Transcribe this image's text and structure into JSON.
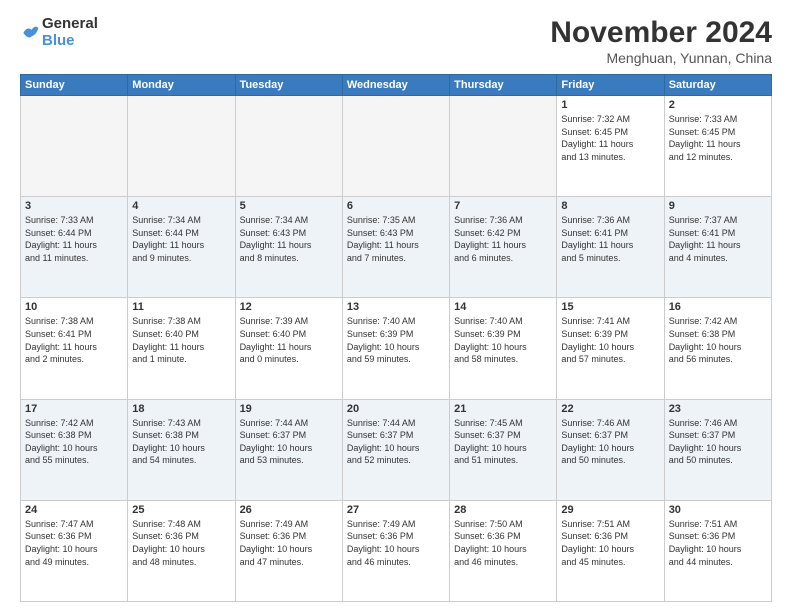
{
  "logo": {
    "line1": "General",
    "line2": "Blue"
  },
  "title": "November 2024",
  "subtitle": "Menghuan, Yunnan, China",
  "days_header": [
    "Sunday",
    "Monday",
    "Tuesday",
    "Wednesday",
    "Thursday",
    "Friday",
    "Saturday"
  ],
  "weeks": [
    [
      {
        "num": "",
        "info": ""
      },
      {
        "num": "",
        "info": ""
      },
      {
        "num": "",
        "info": ""
      },
      {
        "num": "",
        "info": ""
      },
      {
        "num": "",
        "info": ""
      },
      {
        "num": "1",
        "info": "Sunrise: 7:32 AM\nSunset: 6:45 PM\nDaylight: 11 hours\nand 13 minutes."
      },
      {
        "num": "2",
        "info": "Sunrise: 7:33 AM\nSunset: 6:45 PM\nDaylight: 11 hours\nand 12 minutes."
      }
    ],
    [
      {
        "num": "3",
        "info": "Sunrise: 7:33 AM\nSunset: 6:44 PM\nDaylight: 11 hours\nand 11 minutes."
      },
      {
        "num": "4",
        "info": "Sunrise: 7:34 AM\nSunset: 6:44 PM\nDaylight: 11 hours\nand 9 minutes."
      },
      {
        "num": "5",
        "info": "Sunrise: 7:34 AM\nSunset: 6:43 PM\nDaylight: 11 hours\nand 8 minutes."
      },
      {
        "num": "6",
        "info": "Sunrise: 7:35 AM\nSunset: 6:43 PM\nDaylight: 11 hours\nand 7 minutes."
      },
      {
        "num": "7",
        "info": "Sunrise: 7:36 AM\nSunset: 6:42 PM\nDaylight: 11 hours\nand 6 minutes."
      },
      {
        "num": "8",
        "info": "Sunrise: 7:36 AM\nSunset: 6:41 PM\nDaylight: 11 hours\nand 5 minutes."
      },
      {
        "num": "9",
        "info": "Sunrise: 7:37 AM\nSunset: 6:41 PM\nDaylight: 11 hours\nand 4 minutes."
      }
    ],
    [
      {
        "num": "10",
        "info": "Sunrise: 7:38 AM\nSunset: 6:41 PM\nDaylight: 11 hours\nand 2 minutes."
      },
      {
        "num": "11",
        "info": "Sunrise: 7:38 AM\nSunset: 6:40 PM\nDaylight: 11 hours\nand 1 minute."
      },
      {
        "num": "12",
        "info": "Sunrise: 7:39 AM\nSunset: 6:40 PM\nDaylight: 11 hours\nand 0 minutes."
      },
      {
        "num": "13",
        "info": "Sunrise: 7:40 AM\nSunset: 6:39 PM\nDaylight: 10 hours\nand 59 minutes."
      },
      {
        "num": "14",
        "info": "Sunrise: 7:40 AM\nSunset: 6:39 PM\nDaylight: 10 hours\nand 58 minutes."
      },
      {
        "num": "15",
        "info": "Sunrise: 7:41 AM\nSunset: 6:39 PM\nDaylight: 10 hours\nand 57 minutes."
      },
      {
        "num": "16",
        "info": "Sunrise: 7:42 AM\nSunset: 6:38 PM\nDaylight: 10 hours\nand 56 minutes."
      }
    ],
    [
      {
        "num": "17",
        "info": "Sunrise: 7:42 AM\nSunset: 6:38 PM\nDaylight: 10 hours\nand 55 minutes."
      },
      {
        "num": "18",
        "info": "Sunrise: 7:43 AM\nSunset: 6:38 PM\nDaylight: 10 hours\nand 54 minutes."
      },
      {
        "num": "19",
        "info": "Sunrise: 7:44 AM\nSunset: 6:37 PM\nDaylight: 10 hours\nand 53 minutes."
      },
      {
        "num": "20",
        "info": "Sunrise: 7:44 AM\nSunset: 6:37 PM\nDaylight: 10 hours\nand 52 minutes."
      },
      {
        "num": "21",
        "info": "Sunrise: 7:45 AM\nSunset: 6:37 PM\nDaylight: 10 hours\nand 51 minutes."
      },
      {
        "num": "22",
        "info": "Sunrise: 7:46 AM\nSunset: 6:37 PM\nDaylight: 10 hours\nand 50 minutes."
      },
      {
        "num": "23",
        "info": "Sunrise: 7:46 AM\nSunset: 6:37 PM\nDaylight: 10 hours\nand 50 minutes."
      }
    ],
    [
      {
        "num": "24",
        "info": "Sunrise: 7:47 AM\nSunset: 6:36 PM\nDaylight: 10 hours\nand 49 minutes."
      },
      {
        "num": "25",
        "info": "Sunrise: 7:48 AM\nSunset: 6:36 PM\nDaylight: 10 hours\nand 48 minutes."
      },
      {
        "num": "26",
        "info": "Sunrise: 7:49 AM\nSunset: 6:36 PM\nDaylight: 10 hours\nand 47 minutes."
      },
      {
        "num": "27",
        "info": "Sunrise: 7:49 AM\nSunset: 6:36 PM\nDaylight: 10 hours\nand 46 minutes."
      },
      {
        "num": "28",
        "info": "Sunrise: 7:50 AM\nSunset: 6:36 PM\nDaylight: 10 hours\nand 46 minutes."
      },
      {
        "num": "29",
        "info": "Sunrise: 7:51 AM\nSunset: 6:36 PM\nDaylight: 10 hours\nand 45 minutes."
      },
      {
        "num": "30",
        "info": "Sunrise: 7:51 AM\nSunset: 6:36 PM\nDaylight: 10 hours\nand 44 minutes."
      }
    ]
  ]
}
